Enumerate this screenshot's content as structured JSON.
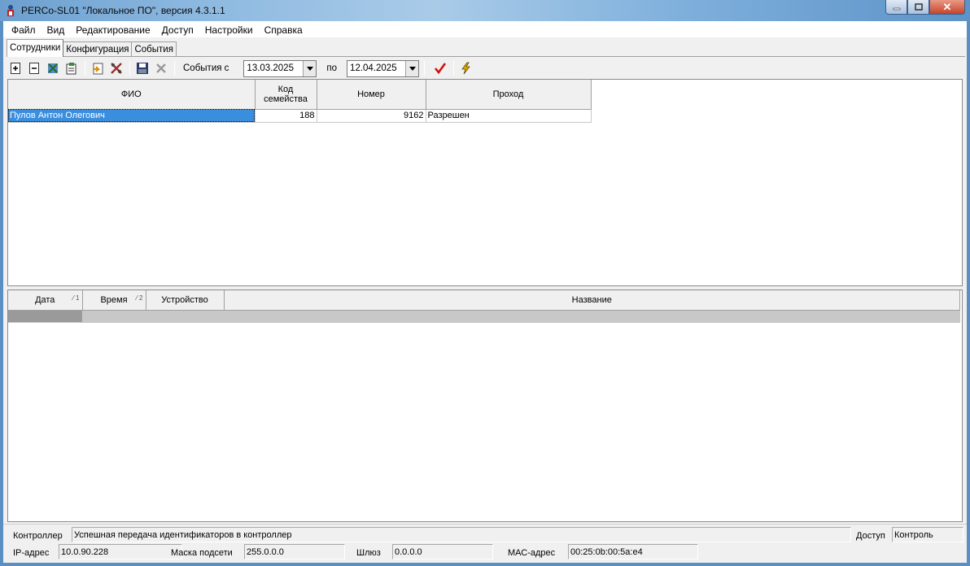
{
  "window": {
    "title": "PERCo-SL01 \"Локальное ПО\", версия 4.3.1.1"
  },
  "menu": [
    "Файл",
    "Вид",
    "Редактирование",
    "Доступ",
    "Настройки",
    "Справка"
  ],
  "tabs": [
    "Сотрудники",
    "Конфигурация",
    "События"
  ],
  "toolbar": {
    "events_from_label": "События с",
    "date_from": "13.03.2025",
    "to_label": "по",
    "date_to": "12.04.2025"
  },
  "employees": {
    "headers": {
      "fio": "ФИО",
      "family_code_1": "Код",
      "family_code_2": "семейства",
      "number": "Номер",
      "pass": "Проход"
    },
    "rows": [
      {
        "fio": "Пулов Антон Олегович",
        "family_code": "188",
        "number": "9162",
        "pass": "Разрешен"
      }
    ]
  },
  "events": {
    "headers": {
      "date": "Дата",
      "date_sort": "1",
      "time": "Время",
      "time_sort": "2",
      "device": "Устройство",
      "name": "Название"
    }
  },
  "status": {
    "controller_label": "Контроллер",
    "controller_msg": "Успешная передача идентификаторов в контроллер",
    "access_label": "Доступ",
    "access_value": "Контроль",
    "ip_label": "IP-адрес",
    "ip_value": "10.0.90.228",
    "mask_label": "Маска подсети",
    "mask_value": "255.0.0.0",
    "gateway_label": "Шлюз",
    "gateway_value": "0.0.0.0",
    "mac_label": "МАС-адрес",
    "mac_value": "00:25:0b:00:5a:e4"
  },
  "colors": {
    "selection": "#3a8ede",
    "accept_check": "#d01010",
    "lightning": "#e0b000"
  }
}
